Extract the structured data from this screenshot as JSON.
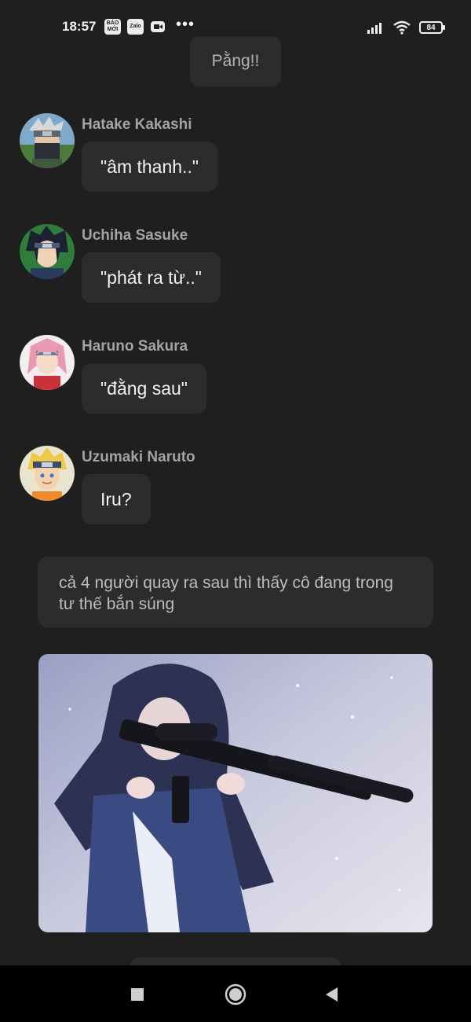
{
  "status_bar": {
    "time": "18:57",
    "apps": [
      {
        "icon": "baomoi-icon",
        "label": "BÁO MỚI"
      },
      {
        "icon": "zalo-icon",
        "label": "Zalo"
      },
      {
        "icon": "video-call-icon",
        "label": ""
      }
    ],
    "more": "•••",
    "battery": "84"
  },
  "sound_effect": "Pằng!!",
  "messages": [
    {
      "sender": "Hatake Kakashi",
      "text": "\"âm thanh..\""
    },
    {
      "sender": "Uchiha Sasuke",
      "text": "\"phát ra từ..\""
    },
    {
      "sender": "Haruno Sakura",
      "text": "\"đằng sau\""
    },
    {
      "sender": "Uzumaki Naruto",
      "text": "Iru?"
    }
  ],
  "narration": "cả 4 người quay ra sau thì thấy cô đang trong tư thế bắn súng",
  "image": {
    "subject": "anime girl with dark hair aiming a rifle in snow"
  },
  "nav_bar": {
    "recents": "recents-square-icon",
    "home": "home-circle-icon",
    "back": "back-triangle-icon"
  },
  "colors": {
    "background": "#1f1f1f",
    "bubble": "#2c2c2c",
    "sender_name": "#a3a3a3",
    "nav_bar": "#000000"
  }
}
